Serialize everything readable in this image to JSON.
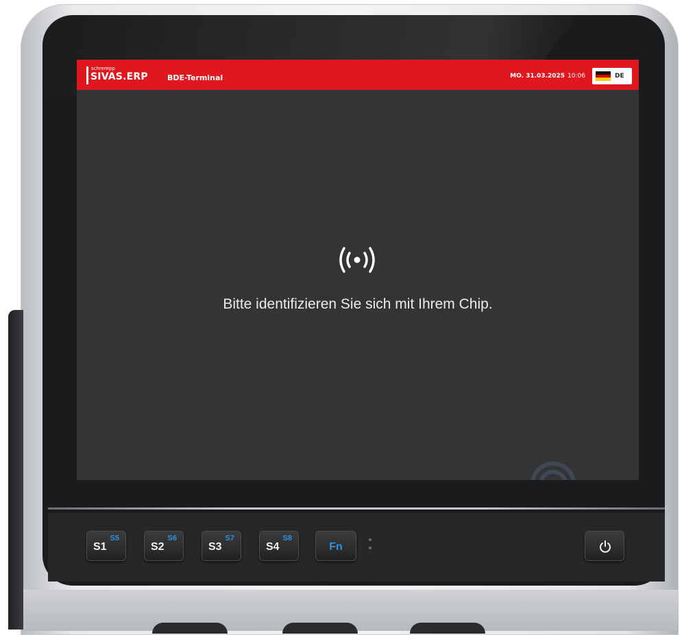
{
  "header": {
    "logo_small": "schrerepp",
    "logo_main": "SIVAS.ERP",
    "app_title": "BDE-Terminal",
    "date": "MO. 31.03.2025",
    "time": "10:06",
    "language": "DE"
  },
  "main": {
    "nfc_icon": "nfc-signal-icon",
    "prompt": "Bitte identifizieren Sie sich mit Ihrem Chip."
  },
  "keypad": {
    "keys": [
      {
        "main": "S1",
        "alt": "S5"
      },
      {
        "main": "S2",
        "alt": "S6"
      },
      {
        "main": "S3",
        "alt": "S7"
      },
      {
        "main": "S4",
        "alt": "S8"
      }
    ],
    "fn_label": "Fn",
    "power_icon": "power-icon"
  },
  "colors": {
    "header_red": "#df1820",
    "screen_bg": "#333436",
    "key_accent_blue": "#2f93e0"
  }
}
